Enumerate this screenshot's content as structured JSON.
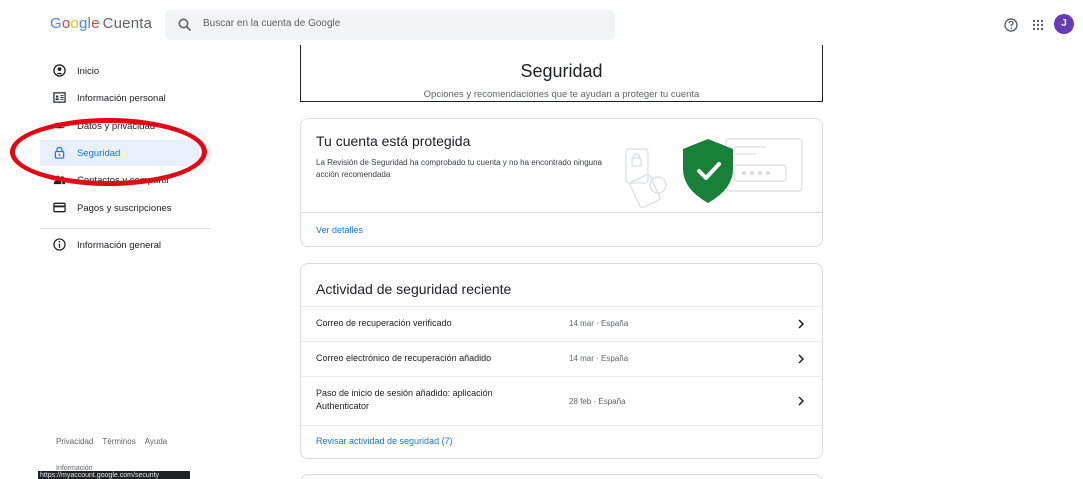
{
  "header": {
    "logo_letters": [
      "G",
      "o",
      "o",
      "g",
      "l",
      "e"
    ],
    "logo_word": "Cuenta",
    "search_placeholder": "Buscar en la cuenta de Google",
    "avatar_initial": "J"
  },
  "sidebar": {
    "items": [
      {
        "label": "Inicio",
        "icon": "home-icon"
      },
      {
        "label": "Información personal",
        "icon": "id-card-icon"
      },
      {
        "label": "Datos y privacidad",
        "icon": "toggle-icon"
      },
      {
        "label": "Seguridad",
        "icon": "lock-icon"
      },
      {
        "label": "Contactos y compartir",
        "icon": "people-icon"
      },
      {
        "label": "Pagos y suscripciones",
        "icon": "credit-card-icon"
      },
      {
        "label": "Información general",
        "icon": "info-icon"
      }
    ],
    "footer": {
      "privacy": "Privacidad",
      "terms": "Términos",
      "help": "Ayuda"
    },
    "status_url": "https://myaccount.google.com/security",
    "peek_text": "Información"
  },
  "page": {
    "title": "Seguridad",
    "subtitle": "Opciones y recomendaciones que te ayudan a proteger tu cuenta"
  },
  "protected_card": {
    "title": "Tu cuenta está protegida",
    "description": "La Revisión de Seguridad ha comprobado tu cuenta y no ha encontrado ninguna acción recomendada",
    "link": "Ver detalles"
  },
  "activity_card": {
    "title": "Actividad de seguridad reciente",
    "rows": [
      {
        "label": "Correo de recuperación verificado",
        "meta": "14 mar · España"
      },
      {
        "label": "Correo electrónico de recuperación añadido",
        "meta": "14 mar · España"
      },
      {
        "label": "Paso de inicio de sesión añadido: aplicación Authenticator",
        "meta": "28 feb · España"
      }
    ],
    "link": "Revisar actividad de seguridad (7)"
  },
  "colors": {
    "accent": "#1a73e8",
    "active_bg": "#e8f0fe",
    "shield": "#188038",
    "annotation": "#e30613",
    "avatar": "#673ab7"
  }
}
